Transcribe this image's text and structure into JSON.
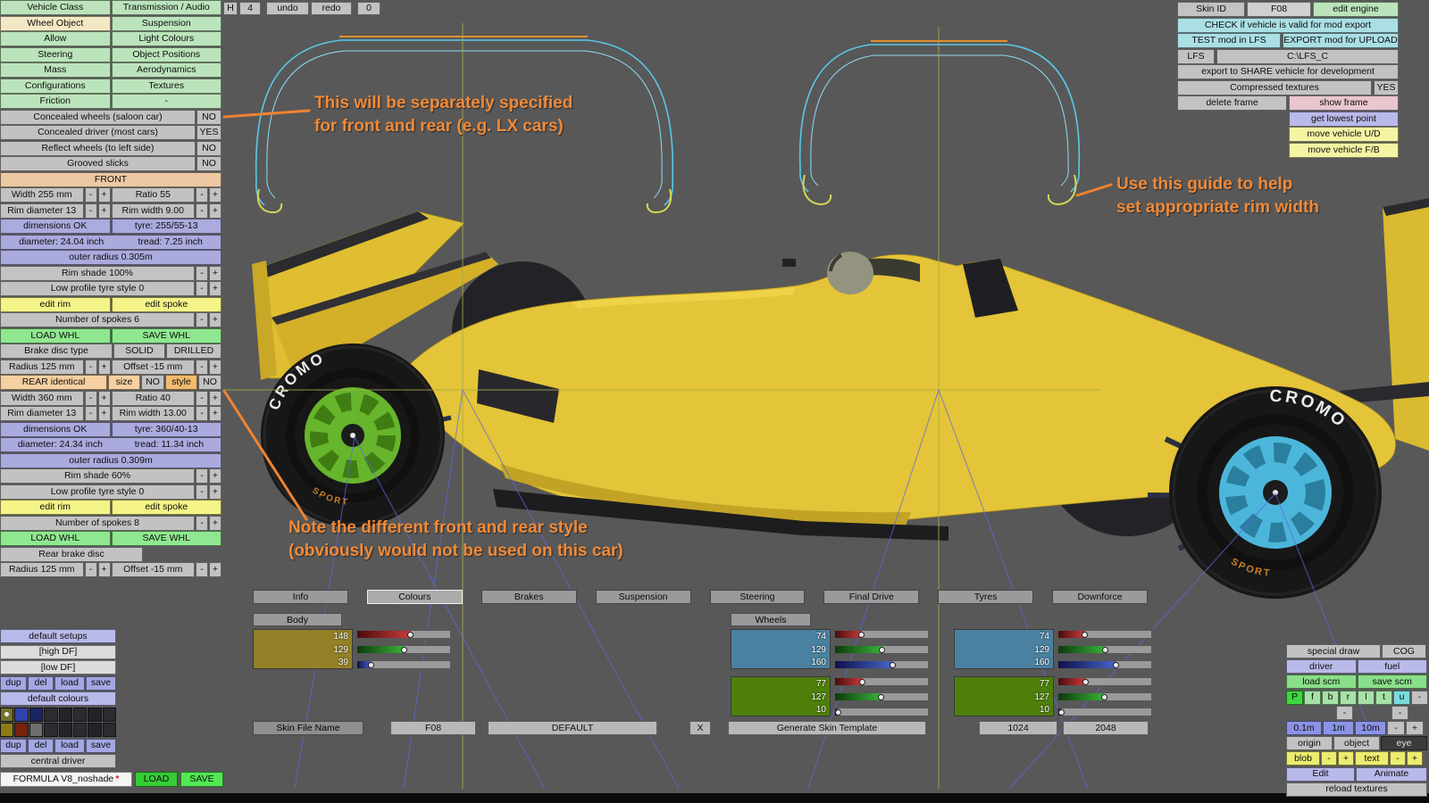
{
  "colors": {
    "accent_orange": "#f08a38",
    "body_swatch": "#948127",
    "wheel_blue_swatch": "#4a81a0",
    "wheel_green_swatch": "#4d7f0a"
  },
  "topbar": {
    "history": "H",
    "frame": "4",
    "undo": "undo",
    "redo": "redo",
    "count": "0"
  },
  "ctrl": {
    "minus": "-",
    "plus": "+"
  },
  "left": {
    "menu": [
      {
        "a": "Vehicle Class",
        "b": "Transmission / Audio"
      },
      {
        "a": "Wheel Object",
        "b": "Suspension"
      },
      {
        "a": "Allow",
        "b": "Light Colours"
      },
      {
        "a": "Steering",
        "b": "Object Positions"
      },
      {
        "a": "Mass",
        "b": "Aerodynamics"
      },
      {
        "a": "Configurations",
        "b": "Textures"
      },
      {
        "a": "Friction",
        "b": "-"
      }
    ],
    "toggles": [
      {
        "label": "Concealed wheels (saloon car)",
        "value": "NO"
      },
      {
        "label": "Concealed driver (most cars)",
        "value": "YES"
      },
      {
        "label": "Reflect wheels (to left side)",
        "value": "NO"
      },
      {
        "label": "Grooved slicks",
        "value": "NO"
      }
    ],
    "front_header": "FRONT",
    "front": {
      "width": "Width 255 mm",
      "ratio": "Ratio 55",
      "rim_diameter": "Rim diameter 13",
      "rim_width": "Rim width 9.00",
      "dimensions": "dimensions OK",
      "tyre": "tyre: 255/55-13",
      "diameter": "diameter: 24.04 inch",
      "tread": "tread: 7.25 inch",
      "outer_radius": "outer radius 0.305m",
      "rim_shade": "Rim shade 100%",
      "low_profile": "Low profile tyre style 0",
      "edit_rim": "edit rim",
      "edit_spoke": "edit spoke",
      "spokes": "Number of spokes 6",
      "load": "LOAD WHL",
      "save": "SAVE WHL"
    },
    "brake": {
      "label": "Brake disc type",
      "solid": "SOLID",
      "drilled": "DRILLED",
      "radius": "Radius 125 mm",
      "offset": "Offset -15 mm"
    },
    "rear_identical": {
      "label": "REAR identical",
      "size": "size",
      "size_val": "NO",
      "style": "style",
      "style_val": "NO"
    },
    "rear": {
      "width": "Width 360 mm",
      "ratio": "Ratio 40",
      "rim_diameter": "Rim diameter 13",
      "rim_width": "Rim width 13.00",
      "dimensions": "dimensions OK",
      "tyre": "tyre: 360/40-13",
      "diameter": "diameter: 24.34 inch",
      "tread": "tread: 11.34 inch",
      "outer_radius": "outer radius 0.309m",
      "rim_shade": "Rim shade 60%",
      "low_profile": "Low profile tyre style 0",
      "edit_rim": "edit rim",
      "edit_spoke": "edit spoke",
      "spokes": "Number of spokes 8",
      "load": "LOAD WHL",
      "save": "SAVE WHL"
    },
    "rear_brake": {
      "label": "Rear brake disc",
      "radius": "Radius 125 mm",
      "offset": "Offset -15 mm"
    }
  },
  "topright": {
    "skin_id": "Skin ID",
    "skin_val": "F08",
    "edit_engine": "edit engine",
    "check": "CHECK if vehicle is valid for mod export",
    "test": "TEST mod in LFS",
    "export": "EXPORT mod for UPLOAD",
    "lfs": "LFS",
    "path": "C:\\LFS_C",
    "share": "export to SHARE vehicle for development",
    "compressed": "Compressed textures",
    "compressed_val": "YES",
    "delete_frame": "delete frame",
    "show_frame": "show frame",
    "lowest": "get lowest point",
    "move_ud": "move vehicle U/D",
    "move_fb": "move vehicle F/B"
  },
  "tabs": [
    {
      "label": "Info"
    },
    {
      "label": "Colours"
    },
    {
      "label": "Brakes"
    },
    {
      "label": "Suspension"
    },
    {
      "label": "Steering"
    },
    {
      "label": "Final Drive"
    },
    {
      "label": "Tyres"
    },
    {
      "label": "Downforce"
    }
  ],
  "colours": {
    "body_label": "Body",
    "wheels_label": "Wheels",
    "body": {
      "r": 148,
      "g": 129,
      "b": 39,
      "hex": "#948127"
    },
    "wheel_blue": {
      "r": 74,
      "g": 129,
      "b": 160,
      "hex": "#4a81a0"
    },
    "wheel_green": {
      "r": 77,
      "g": 127,
      "b": 10,
      "hex": "#4d7f0a"
    }
  },
  "skin": {
    "label": "Skin File Name",
    "name": "F08",
    "default": "DEFAULT",
    "x": "X",
    "generate": "Generate Skin Template",
    "res1": "1024",
    "res2": "2048"
  },
  "bottomleft": {
    "default_setups": "default setups",
    "high_df": "[high DF]",
    "low_df": "[low DF]",
    "small_buttons": [
      "dup",
      "del",
      "load",
      "save"
    ],
    "default_colours": "default colours",
    "palette_row1": [
      "#73732b",
      "#2f43ae",
      "#1b2466",
      "#2b2b33",
      "#23232b",
      "#2b2b33",
      "#23232b",
      "#2b2b33"
    ],
    "palette_row2": [
      "#8d7c15",
      "#77220f",
      "#6f6f6f",
      "#2b2b33",
      "#23232b",
      "#2b2b33",
      "#23232b",
      "#2b2b33"
    ],
    "central_driver": "central driver",
    "vehicle_name": "FORMULA V8_noshade",
    "modified_marker": "*",
    "load_big": "LOAD",
    "save_big": "SAVE"
  },
  "bottomright": {
    "special_draw": "special draw",
    "cog": "COG",
    "driver": "driver",
    "fuel": "fuel",
    "load_scm": "load scm",
    "save_scm": "save scm",
    "letters": [
      "P",
      "f",
      "b",
      "r",
      "l",
      "t",
      "u",
      "-"
    ],
    "dashes": [
      "-",
      "-"
    ],
    "grid": [
      "0.1m",
      "1m",
      "10m"
    ],
    "origin": "origin",
    "object": "object",
    "eye": "eye",
    "blob": "blob",
    "text": "text",
    "edit": "Edit",
    "animate": "Animate",
    "reload": "reload textures"
  },
  "viewport": {
    "tyre_brand": "CROMO",
    "tyre_sub": "SPORT",
    "note1a": "This will be separately specified",
    "note1b": "for front and rear (e.g. LX cars)",
    "note2a": "Use this guide to help",
    "note2b": "set appropriate rim width",
    "note3a": "Note the different front and rear style",
    "note3b": "(obviously would not be used on this car)"
  }
}
